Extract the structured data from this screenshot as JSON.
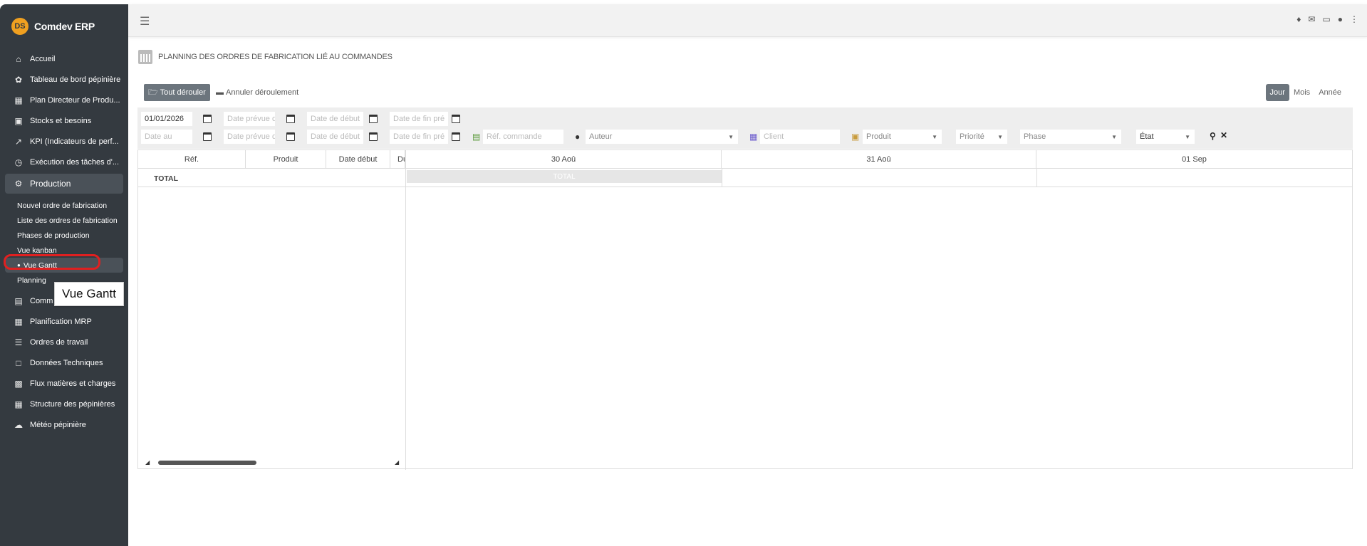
{
  "app": {
    "brand_name": "Comdev ERP",
    "brand_logo_text": "DS"
  },
  "sidebar": {
    "items": [
      {
        "label": "Accueil",
        "icon": "home-icon"
      },
      {
        "label": "Tableau de bord pépinière",
        "icon": "leaf-icon"
      },
      {
        "label": "Plan Directeur de Produ...",
        "icon": "calendar-icon"
      },
      {
        "label": "Stocks et besoins",
        "icon": "boxes-icon"
      },
      {
        "label": "KPI (Indicateurs de perf...",
        "icon": "chart-line-icon"
      },
      {
        "label": "Exécution des tâches d'...",
        "icon": "clock-icon"
      },
      {
        "label": "Production",
        "icon": "cogs-icon"
      }
    ],
    "production_sub": [
      {
        "label": "Nouvel ordre de fabrication"
      },
      {
        "label": "Liste des ordres de fabrication"
      },
      {
        "label": "Phases de production"
      },
      {
        "label": "Vue kanban"
      },
      {
        "label": "Vue Gantt"
      },
      {
        "label": "Planning"
      }
    ],
    "items_after": [
      {
        "label": "Comm",
        "icon": "document-icon"
      },
      {
        "label": "Planification MRP",
        "icon": "calendar-icon"
      },
      {
        "label": "Ordres de travail",
        "icon": "list-icon"
      },
      {
        "label": "Données Techniques",
        "icon": "file-icon"
      },
      {
        "label": "Flux matières et charges",
        "icon": "truck-icon"
      },
      {
        "label": "Structure des pépinières",
        "icon": "building-icon"
      },
      {
        "label": "Météo pépinière",
        "icon": "cloud-icon"
      }
    ],
    "tooltip": "Vue Gantt"
  },
  "topbar": {
    "menu_icon": "hamburger-icon"
  },
  "page": {
    "title": "PLANNING DES ORDRES DE FABRICATION LIÉ AU COMMANDES",
    "expand_label": "Tout dérouler",
    "collapse_label": "Annuler déroulement",
    "views": [
      "Jour",
      "Mois",
      "Année"
    ],
    "active_view": "Jour"
  },
  "filters": {
    "date_from_value": "01/01/2026",
    "date_to_placeholder": "Date au",
    "date_prevue_1": "Date prévue de",
    "date_prevue_2": "Date prévue de",
    "date_debut_1": "Date de début",
    "date_debut_2": "Date de début",
    "date_fin_1": "Date de fin pré",
    "date_fin_2": "Date de fin pré",
    "ref_commande": "Réf. commande",
    "auteur": "Auteur",
    "client": "Client",
    "produit": "Produit",
    "priorite": "Priorité",
    "phase": "Phase",
    "etat": "État"
  },
  "gantt": {
    "columns": [
      "Réf.",
      "Produit",
      "Date début",
      "Du"
    ],
    "dates": [
      "30 Aoû",
      "31 Aoû",
      "01 Sep"
    ],
    "total_label": "TOTAL",
    "total_bar_label": "TOTAL"
  }
}
